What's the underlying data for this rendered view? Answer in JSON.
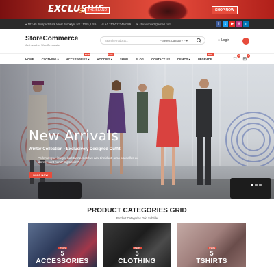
{
  "promo": {
    "title": "EXCLUSIVE",
    "script": "Sale",
    "tag": "THE BLAND",
    "shop": "SHOP NOW"
  },
  "topbar": {
    "address": "107-95 Prospect Park West Brooklyn, NY 11215, USA",
    "phone": "+1 212-0123456789",
    "email": "storecontact@email.com",
    "social": [
      {
        "icon": "facebook-icon",
        "glyph": "f",
        "color": "#3b5998"
      },
      {
        "icon": "twitter-icon",
        "glyph": "t",
        "color": "#1da1f2"
      },
      {
        "icon": "youtube-icon",
        "glyph": "▶",
        "color": "#e52d27"
      },
      {
        "icon": "instagram-icon",
        "glyph": "◎",
        "color": "#c13584"
      },
      {
        "icon": "linkedin-icon",
        "glyph": "in",
        "color": "#0077b5"
      }
    ]
  },
  "header": {
    "logo": "StoreCommerce",
    "tagline": "Just another WordPress site",
    "search_placeholder": "Search Products...",
    "category_select": "-- Select Category --",
    "login": "Login"
  },
  "nav": {
    "items": [
      {
        "label": "HOME",
        "badge": ""
      },
      {
        "label": "CLOTHING",
        "badge": ""
      },
      {
        "label": "ACCESSORIES",
        "badge": "NEW"
      },
      {
        "label": "HOODIES",
        "badge": "HOT"
      },
      {
        "label": "SHOP",
        "badge": ""
      },
      {
        "label": "BLOG",
        "badge": ""
      },
      {
        "label": "CONTACT US",
        "badge": ""
      },
      {
        "label": "DEMOS",
        "badge": ""
      },
      {
        "label": "UPGRADE",
        "badge": "PRO"
      }
    ],
    "wishlist_count": "0",
    "cart_count": "0"
  },
  "hero": {
    "title": "New Arrivals",
    "subtitle": "Winter Collection - Exclusively Designed Outfit",
    "description": "Pellentesque integer habitant penatibus wisi tincidunt, urna phasellus eu laoreet sunt nunc! Dignissim?",
    "button": "SHOP NOW",
    "slides": 3,
    "active_slide": 1
  },
  "categories": {
    "title": "PRODUCT CATEGORIES GRID",
    "subtitle": "Product Categories Grid Subtitle",
    "items": [
      {
        "tag": "ITEMS",
        "count": "5",
        "name": "ACCESSORIES"
      },
      {
        "tag": "ITEMS",
        "count": "5",
        "name": "CLOTHING"
      },
      {
        "tag": "ITEMS",
        "count": "5",
        "name": "TSHIRTS"
      }
    ]
  },
  "colors": {
    "accent": "#e74c3c",
    "topbar": "#2b2b2b"
  }
}
